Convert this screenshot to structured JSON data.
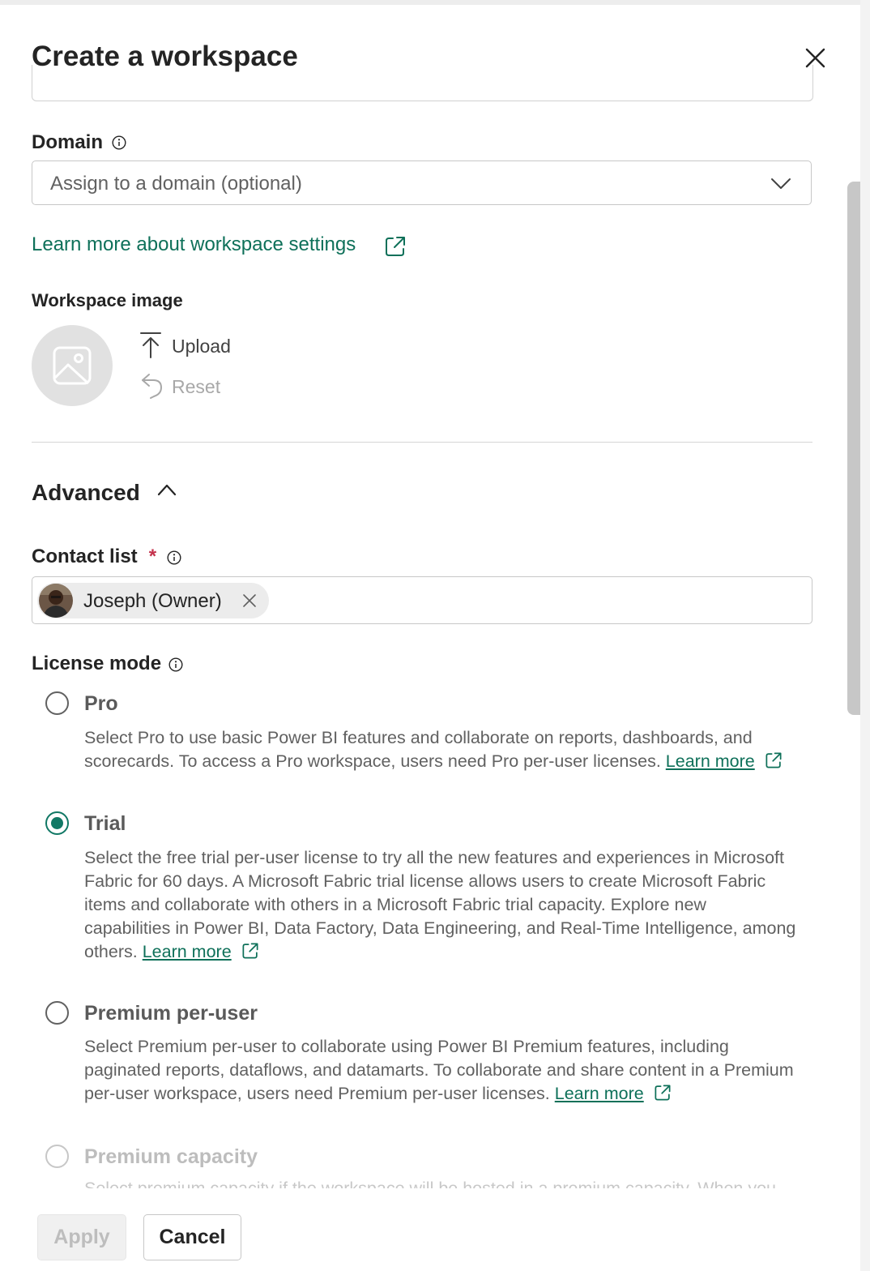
{
  "dialog": {
    "title": "Create a workspace",
    "close_label": "Close"
  },
  "domain": {
    "label": "Domain",
    "placeholder": "Assign to a domain (optional)"
  },
  "settings_link": "Learn more about workspace settings",
  "workspace_image": {
    "label": "Workspace image",
    "upload_label": "Upload",
    "reset_label": "Reset"
  },
  "advanced": {
    "label": "Advanced",
    "expanded": true
  },
  "contact_list": {
    "label": "Contact list",
    "required_mark": "*",
    "chips": [
      {
        "name": "Joseph (Owner)"
      }
    ]
  },
  "license_mode": {
    "label": "License mode",
    "selected": "Trial",
    "options": [
      {
        "title": "Pro",
        "description": "Select Pro to use basic Power BI features and collaborate on reports, dashboards, and scorecards. To access a Pro workspace, users need Pro per-user licenses.",
        "link": "Learn more"
      },
      {
        "title": "Trial",
        "description": "Select the free trial per-user license to try all the new features and experiences in Microsoft Fabric for 60 days. A Microsoft Fabric trial license allows users to create Microsoft Fabric items and collaborate with others in a Microsoft Fabric trial capacity. Explore new capabilities in Power BI, Data Factory, Data Engineering, and Real-Time Intelligence, among others.",
        "link": "Learn more"
      },
      {
        "title": "Premium per-user",
        "description": "Select Premium per-user to collaborate using Power BI Premium features, including paginated reports, dataflows, and datamarts. To collaborate and share content in a Premium per-user workspace, users need Premium per-user licenses.",
        "link": "Learn more"
      },
      {
        "title": "Premium capacity",
        "description": "Select premium capacity if the workspace will be hosted in a premium capacity. When you"
      }
    ]
  },
  "footer": {
    "apply_label": "Apply",
    "cancel_label": "Cancel"
  },
  "colors": {
    "accent": "#117865",
    "link": "#0e7059",
    "required": "#c4314b"
  }
}
